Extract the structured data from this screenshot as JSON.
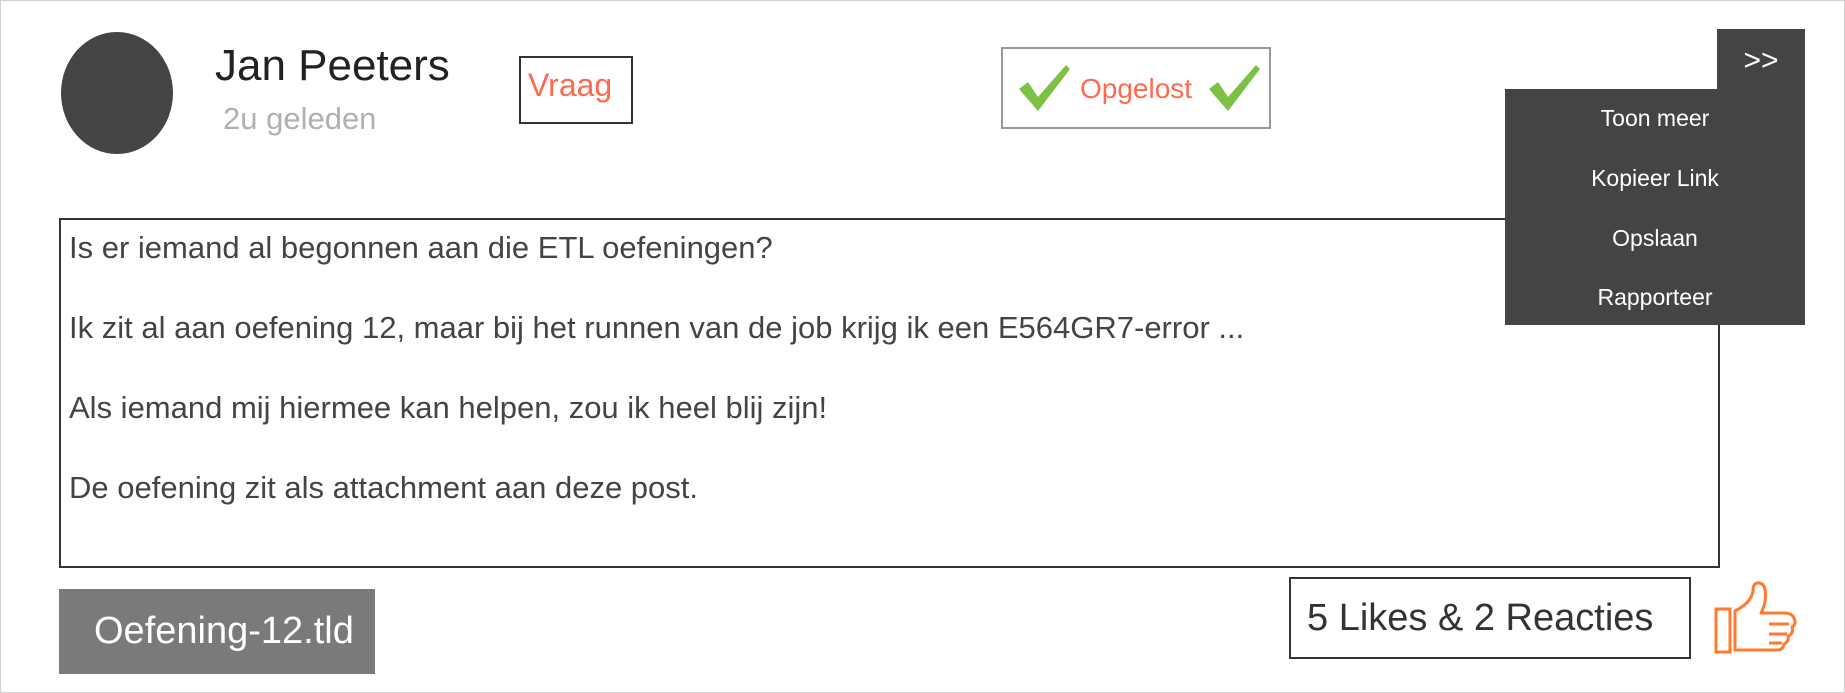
{
  "post": {
    "author": "Jan Peeters",
    "timestamp": "2u geleden",
    "type_badge": "Vraag",
    "status": "Opgelost",
    "body": [
      "Is er iemand al begonnen aan die ETL oefeningen?",
      "Ik zit al aan oefening 12, maar bij het runnen van de job krijg ik een E564GR7-error ...",
      "Als iemand mij hiermee kan helpen, zou ik heel blij zijn!",
      "De oefening zit als attachment aan deze post."
    ],
    "attachment": "Oefening-12.tld",
    "reactions_summary": "5 Likes & 2 Reacties"
  },
  "menu": {
    "toggle_label": ">>",
    "items": [
      "Toon meer",
      "Kopieer Link",
      "Opslaan",
      "Rapporteer"
    ]
  },
  "icons": {
    "avatar": "avatar",
    "status": "checkmark-icon",
    "like": "thumbs-up-icon"
  },
  "colors": {
    "accent": "#ff6a4d",
    "check": "#7dc142",
    "menu_bg": "#444444",
    "attachment_bg": "#7a7a7a",
    "like_icon": "#ff7a2e"
  }
}
